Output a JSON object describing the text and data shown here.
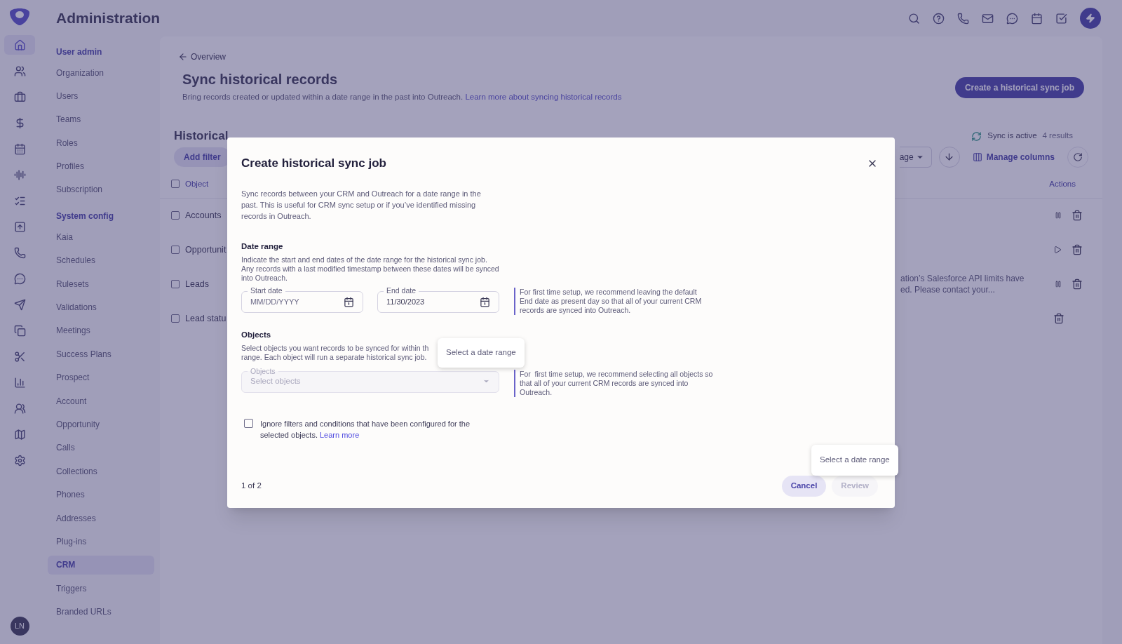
{
  "header": {
    "title": "Administration"
  },
  "rail": {
    "items": [
      {
        "selected": true
      },
      {
        "selected": false
      },
      {
        "selected": false
      },
      {
        "selected": false
      },
      {
        "selected": false
      },
      {
        "selected": false
      },
      {
        "selected": false
      },
      {
        "selected": false
      },
      {
        "selected": false
      },
      {
        "selected": false
      },
      {
        "selected": false
      },
      {
        "selected": false
      },
      {
        "selected": false
      },
      {
        "selected": false
      },
      {
        "selected": false
      },
      {
        "selected": false
      },
      {
        "selected": false
      }
    ],
    "user_initials": "LN"
  },
  "nav": {
    "sections": [
      {
        "title": "User admin",
        "items": [
          {
            "label": "Organization",
            "selected": false
          },
          {
            "label": "Users",
            "selected": false
          },
          {
            "label": "Teams",
            "selected": false
          },
          {
            "label": "Roles",
            "selected": false
          },
          {
            "label": "Profiles",
            "selected": false
          },
          {
            "label": "Subscription",
            "selected": false
          }
        ]
      },
      {
        "title": "System config",
        "items": [
          {
            "label": "Kaia",
            "selected": false
          },
          {
            "label": "Schedules",
            "selected": false
          },
          {
            "label": "Rulesets",
            "selected": false
          },
          {
            "label": "Validations",
            "selected": false
          },
          {
            "label": "Meetings",
            "selected": false
          },
          {
            "label": "Success Plans",
            "selected": false
          },
          {
            "label": "Prospect",
            "selected": false
          },
          {
            "label": "Account",
            "selected": false
          },
          {
            "label": "Opportunity",
            "selected": false
          },
          {
            "label": "Calls",
            "selected": false
          },
          {
            "label": "Collections",
            "selected": false
          },
          {
            "label": "Phones",
            "selected": false
          },
          {
            "label": "Addresses",
            "selected": false
          },
          {
            "label": "Plug-ins",
            "selected": false
          },
          {
            "label": "CRM",
            "selected": true
          },
          {
            "label": "Triggers",
            "selected": false
          },
          {
            "label": "Branded URLs",
            "selected": false
          }
        ]
      }
    ]
  },
  "page": {
    "back_link": "Overview",
    "title": "Sync historical records",
    "description": "Bring records created or updated within a date range in the past into Outreach.",
    "learn_more_link": "Learn more about syncing historical records",
    "create_button": "Create a historical sync job"
  },
  "jobs": {
    "heading": "Historical",
    "add_filter": "Add filter",
    "sync_status": "Sync is active",
    "results": "4 results",
    "per_page_dropdown": "age",
    "manage_columns": "Manage columns",
    "columns": [
      "Object",
      "Actions"
    ],
    "select_all_checked": false,
    "rows": [
      {
        "object": "Accounts",
        "kind": "pause",
        "checked": false,
        "message": []
      },
      {
        "object": "Opportunit",
        "kind": "play",
        "checked": false,
        "message": []
      },
      {
        "object": "Leads",
        "kind": "pause",
        "checked": false,
        "message": [
          "ation’s Salesforce API limits have",
          "ed. Please contact your..."
        ]
      },
      {
        "object": "Lead statu",
        "kind": "none",
        "checked": false,
        "message": []
      }
    ]
  },
  "dialog": {
    "title": "Create historical sync job",
    "intro": "Sync records between your CRM and Outreach for a date range in the past. This is useful for CRM sync setup or if you’ve identified missing records in Outreach.",
    "date_range": {
      "heading": "Date range",
      "description": "Indicate the start and end dates of the date range for the historical sync job. Any records with a last modified timestamp between these dates will be synced into Outreach.",
      "start": {
        "label": "Start date",
        "placeholder": "MM/DD/YYYY"
      },
      "end": {
        "label": "End date",
        "value": "11/30/2023"
      },
      "hint": "For first time setup, we recommend leaving the default End date as present day so that all of your current CRM records are synced into Outreach."
    },
    "objects": {
      "heading": "Objects",
      "description_lines": [
        "Select objects you want records to be synced for within th",
        "range. Each object will run a separate historical sync job."
      ],
      "field": {
        "label": "Objects",
        "placeholder": "Select objects",
        "disabled": true
      },
      "hint": "For  first time setup, we recommend selecting all objects so that all of your current CRM records are synced into Outreach."
    },
    "ignore_filters": {
      "label": "Ignore filters and conditions that have been configured for the selected objects.",
      "link": "Learn more",
      "checked": false
    },
    "step": "1 of 2",
    "cancel": "Cancel",
    "review": {
      "label": "Review",
      "disabled": true
    },
    "tooltips": [
      "Select a date range",
      "Select a date range"
    ]
  }
}
